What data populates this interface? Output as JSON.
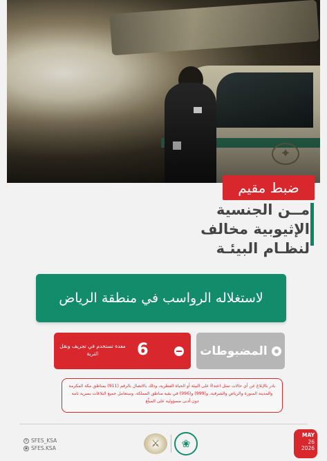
{
  "colors": {
    "accent_red": "#d8282d",
    "accent_green": "#138c6c",
    "gray_badge": "#b6b6b6",
    "background": "#f2f2f2"
  },
  "header": {
    "tag": "ضبط مقيم",
    "headline_lines": [
      "مــن الجنسية",
      "الإثيوبية مخالف",
      "لنظـام البيئـة"
    ]
  },
  "reason": {
    "text": "لاستغلاله الرواسب في منطقة الرياض"
  },
  "stats": {
    "seized_label": "المضبوطات",
    "seized_icon": "circle-dot-icon",
    "item_count": "6",
    "item_description": "معدة تستخدم في تجريف ونقل التربة",
    "item_icon": "minus-circle-icon"
  },
  "notice": {
    "text": "بادر بالإبلاغ عن أي حالات تمثل اعتداءً على البيئة أو الحياة الفطرية، وذلك بالاتصال بالرقم (911) بمناطق مكة المكرمة والمدينة المنورة والرياض والشرقية، و(999) و(996) في بقية مناطق المملكة، وستعامل جميع البلاغات بسرية تامة دون أدنى مسؤولية على المبلّغ"
  },
  "footer": {
    "social": [
      {
        "icon": "x-icon",
        "handle": "SFES_KSA"
      },
      {
        "icon": "instagram-icon",
        "handle": "SFES.KSA"
      }
    ],
    "date": {
      "month": "MAY",
      "day": "26",
      "year": "2026"
    }
  }
}
